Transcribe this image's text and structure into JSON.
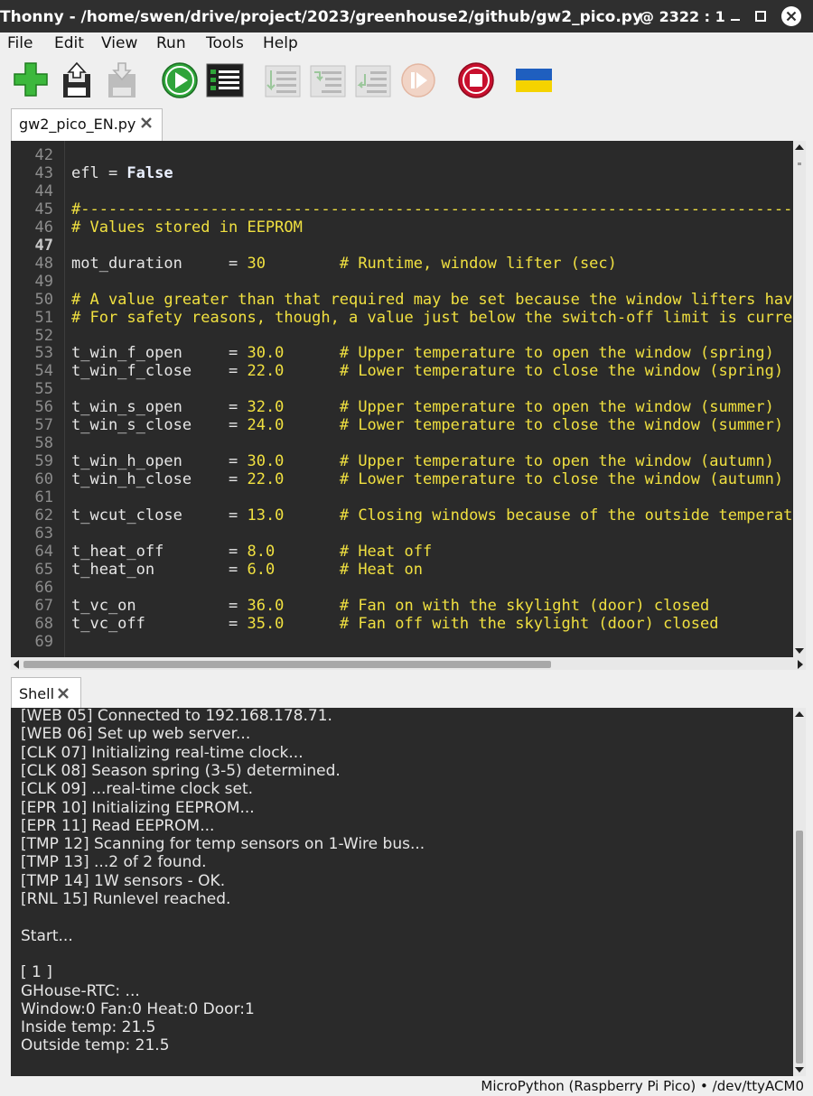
{
  "window": {
    "title": "Thonny  -  /home/swen/drive/project/2023/greenhouse2/github/gw2_pico.py",
    "cursor_position": "@  2322 : 1"
  },
  "menu": [
    "File",
    "Edit",
    "View",
    "Run",
    "Tools",
    "Help"
  ],
  "toolbar": {
    "buttons": [
      {
        "name": "new-file",
        "icon": "plus-icon",
        "enabled": true
      },
      {
        "name": "save-file",
        "icon": "floppy-upload-icon",
        "enabled": true
      },
      {
        "name": "save-device",
        "icon": "floppy-download-icon",
        "enabled": false
      },
      {
        "name": "run",
        "icon": "play-icon",
        "enabled": true
      },
      {
        "name": "debug",
        "icon": "debug-icon",
        "enabled": true
      },
      {
        "name": "step-over",
        "icon": "step-over-icon",
        "enabled": false
      },
      {
        "name": "step-into",
        "icon": "step-into-icon",
        "enabled": false
      },
      {
        "name": "step-out",
        "icon": "step-out-icon",
        "enabled": false
      },
      {
        "name": "resume",
        "icon": "resume-icon",
        "enabled": false
      },
      {
        "name": "stop",
        "icon": "stop-icon",
        "enabled": true
      },
      {
        "name": "support-ukraine",
        "icon": "ukraine-flag-icon",
        "enabled": true
      }
    ]
  },
  "editor": {
    "tab_label": "gw2_pico_EN.py",
    "current_line": 47,
    "lines": [
      {
        "n": "42",
        "t": []
      },
      {
        "n": "43",
        "t": [
          [
            "",
            "efl = "
          ],
          [
            "kw",
            "False"
          ]
        ]
      },
      {
        "n": "44",
        "t": []
      },
      {
        "n": "45",
        "t": [
          [
            "cmt",
            "#-----------------------------------------------------------------------------------"
          ]
        ]
      },
      {
        "n": "46",
        "t": [
          [
            "cmt",
            "# Values stored in EEPROM"
          ]
        ]
      },
      {
        "n": "47",
        "t": []
      },
      {
        "n": "48",
        "t": [
          [
            "",
            "mot_duration     = "
          ],
          [
            "num",
            "30"
          ],
          [
            "",
            "        "
          ],
          [
            "cmt",
            "# Runtime, window lifter (sec)"
          ]
        ]
      },
      {
        "n": "49",
        "t": []
      },
      {
        "n": "50",
        "t": [
          [
            "cmt",
            "# A value greater than that required may be set because the window lifters have"
          ]
        ]
      },
      {
        "n": "51",
        "t": [
          [
            "cmt",
            "# For safety reasons, though, a value just below the switch-off limit is current"
          ]
        ]
      },
      {
        "n": "52",
        "t": []
      },
      {
        "n": "53",
        "t": [
          [
            "",
            "t_win_f_open     = "
          ],
          [
            "num",
            "30.0"
          ],
          [
            "",
            "      "
          ],
          [
            "cmt",
            "# Upper temperature to open the window (spring)"
          ]
        ]
      },
      {
        "n": "54",
        "t": [
          [
            "",
            "t_win_f_close    = "
          ],
          [
            "num",
            "22.0"
          ],
          [
            "",
            "      "
          ],
          [
            "cmt",
            "# Lower temperature to close the window (spring)"
          ]
        ]
      },
      {
        "n": "55",
        "t": []
      },
      {
        "n": "56",
        "t": [
          [
            "",
            "t_win_s_open     = "
          ],
          [
            "num",
            "32.0"
          ],
          [
            "",
            "      "
          ],
          [
            "cmt",
            "# Upper temperature to open the window (summer)"
          ]
        ]
      },
      {
        "n": "57",
        "t": [
          [
            "",
            "t_win_s_close    = "
          ],
          [
            "num",
            "24.0"
          ],
          [
            "",
            "      "
          ],
          [
            "cmt",
            "# Lower temperature to close the window (summer)"
          ]
        ]
      },
      {
        "n": "58",
        "t": []
      },
      {
        "n": "59",
        "t": [
          [
            "",
            "t_win_h_open     = "
          ],
          [
            "num",
            "30.0"
          ],
          [
            "",
            "      "
          ],
          [
            "cmt",
            "# Upper temperature to open the window (autumn)"
          ]
        ]
      },
      {
        "n": "60",
        "t": [
          [
            "",
            "t_win_h_close    = "
          ],
          [
            "num",
            "22.0"
          ],
          [
            "",
            "      "
          ],
          [
            "cmt",
            "# Lower temperature to close the window (autumn)"
          ]
        ]
      },
      {
        "n": "61",
        "t": []
      },
      {
        "n": "62",
        "t": [
          [
            "",
            "t_wcut_close     = "
          ],
          [
            "num",
            "13.0"
          ],
          [
            "",
            "      "
          ],
          [
            "cmt",
            "# Closing windows because of the outside temperatur"
          ]
        ]
      },
      {
        "n": "63",
        "t": []
      },
      {
        "n": "64",
        "t": [
          [
            "",
            "t_heat_off       = "
          ],
          [
            "num",
            "8.0"
          ],
          [
            "",
            "       "
          ],
          [
            "cmt",
            "# Heat off"
          ]
        ]
      },
      {
        "n": "65",
        "t": [
          [
            "",
            "t_heat_on        = "
          ],
          [
            "num",
            "6.0"
          ],
          [
            "",
            "       "
          ],
          [
            "cmt",
            "# Heat on"
          ]
        ]
      },
      {
        "n": "66",
        "t": []
      },
      {
        "n": "67",
        "t": [
          [
            "",
            "t_vc_on          = "
          ],
          [
            "num",
            "36.0"
          ],
          [
            "",
            "      "
          ],
          [
            "cmt",
            "# Fan on with the skylight (door) closed"
          ]
        ]
      },
      {
        "n": "68",
        "t": [
          [
            "",
            "t_vc_off         = "
          ],
          [
            "num",
            "35.0"
          ],
          [
            "",
            "      "
          ],
          [
            "cmt",
            "# Fan off with the skylight (door) closed"
          ]
        ]
      },
      {
        "n": "69",
        "t": []
      }
    ]
  },
  "shell": {
    "tab_label": "Shell",
    "lines": [
      "[WEB 05] Connected to 192.168.178.71.",
      "[WEB 06] Set up web server...",
      "[CLK 07] Initializing real-time clock...",
      "[CLK 08] Season spring (3-5) determined.",
      "[CLK 09] ...real-time clock set.",
      "[EPR 10] Initializing EEPROM...",
      "[EPR 11] Read EEPROM...",
      "[TMP 12] Scanning for temp sensors on 1-Wire bus...",
      "[TMP 13] ...2 of 2 found.",
      "[TMP 14] 1W sensors - OK.",
      "[RNL 15] Runlevel reached.",
      "",
      "Start...",
      "",
      "[ 1 ]",
      "GHouse-RTC: ...",
      "Window:0 Fan:0 Heat:0 Door:1",
      "Inside temp: 21.5",
      "Outside temp: 21.5"
    ]
  },
  "status_bar": {
    "text": "MicroPython (Raspberry Pi Pico)  •  /dev/ttyACM0"
  },
  "colors": {
    "editor_bg": "#2a2a2a",
    "comment": "#f0e040",
    "number": "#f0e040",
    "keyword": "#eaf0ff",
    "text": "#e6e6e6",
    "line_number": "#8d8d8d",
    "titlebar": "#2f2f2f"
  }
}
